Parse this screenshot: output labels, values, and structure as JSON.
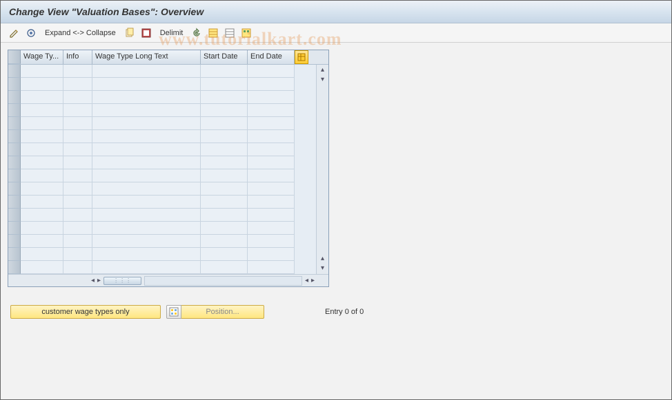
{
  "title": "Change View \"Valuation Bases\": Overview",
  "toolbar": {
    "expand_collapse": "Expand <-> Collapse",
    "delimit": "Delimit"
  },
  "table": {
    "columns": {
      "wage_type": "Wage Ty...",
      "info": "Info",
      "long_text": "Wage Type Long Text",
      "start_date": "Start Date",
      "end_date": "End Date"
    },
    "rows": [
      {
        "wage_type": "",
        "info": "",
        "long_text": "",
        "start_date": "",
        "end_date": ""
      },
      {
        "wage_type": "",
        "info": "",
        "long_text": "",
        "start_date": "",
        "end_date": ""
      },
      {
        "wage_type": "",
        "info": "",
        "long_text": "",
        "start_date": "",
        "end_date": ""
      },
      {
        "wage_type": "",
        "info": "",
        "long_text": "",
        "start_date": "",
        "end_date": ""
      },
      {
        "wage_type": "",
        "info": "",
        "long_text": "",
        "start_date": "",
        "end_date": ""
      },
      {
        "wage_type": "",
        "info": "",
        "long_text": "",
        "start_date": "",
        "end_date": ""
      },
      {
        "wage_type": "",
        "info": "",
        "long_text": "",
        "start_date": "",
        "end_date": ""
      },
      {
        "wage_type": "",
        "info": "",
        "long_text": "",
        "start_date": "",
        "end_date": ""
      },
      {
        "wage_type": "",
        "info": "",
        "long_text": "",
        "start_date": "",
        "end_date": ""
      },
      {
        "wage_type": "",
        "info": "",
        "long_text": "",
        "start_date": "",
        "end_date": ""
      },
      {
        "wage_type": "",
        "info": "",
        "long_text": "",
        "start_date": "",
        "end_date": ""
      },
      {
        "wage_type": "",
        "info": "",
        "long_text": "",
        "start_date": "",
        "end_date": ""
      },
      {
        "wage_type": "",
        "info": "",
        "long_text": "",
        "start_date": "",
        "end_date": ""
      },
      {
        "wage_type": "",
        "info": "",
        "long_text": "",
        "start_date": "",
        "end_date": ""
      },
      {
        "wage_type": "",
        "info": "",
        "long_text": "",
        "start_date": "",
        "end_date": ""
      },
      {
        "wage_type": "",
        "info": "",
        "long_text": "",
        "start_date": "",
        "end_date": ""
      }
    ]
  },
  "buttons": {
    "customer_wage": "customer wage types only",
    "position": "Position..."
  },
  "status": {
    "entry": "Entry 0 of 0"
  },
  "watermark": "www.tutorialkart.com"
}
